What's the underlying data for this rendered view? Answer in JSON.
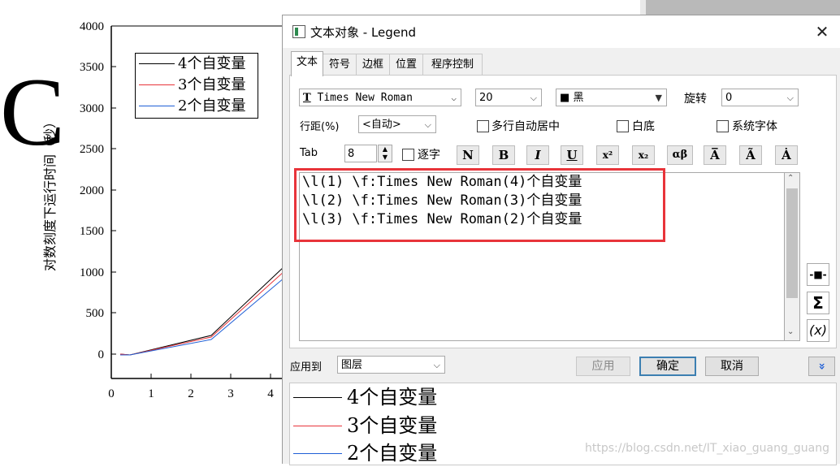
{
  "plot": {
    "big_letter": "C",
    "y_axis_label": "对数刻度下运行时间（秒）",
    "y_ticks": [
      "4000",
      "3500",
      "3000",
      "2500",
      "2000",
      "1500",
      "1000",
      "500",
      "0"
    ],
    "x_ticks": [
      "0",
      "1",
      "2",
      "3",
      "4"
    ],
    "legend": [
      {
        "label": "4个自变量",
        "color": "#000000"
      },
      {
        "label": "3个自变量",
        "color": "#e8343a"
      },
      {
        "label": "2个自变量",
        "color": "#1f5fd6"
      }
    ]
  },
  "dialog": {
    "title": "文本对象 - Legend",
    "close_glyph": "✕",
    "tabs": [
      "文本",
      "符号",
      "边框",
      "位置",
      "程序控制"
    ],
    "font_combo": "Times New Roman",
    "font_icon": "T",
    "size_combo": "20",
    "color_combo": "黑",
    "rotate_label": "旋转",
    "rotate_combo": "0",
    "line_spacing_label": "行距(%)",
    "line_spacing_combo": "<自动>",
    "multiline_center_label": "多行自动居中",
    "white_bg_label": "白底",
    "system_font_label": "系统字体",
    "tab_label": "Tab",
    "tab_value": "8",
    "char_by_char_label": "逐字",
    "format_buttons": [
      "N",
      "B",
      "I",
      "U",
      "x²",
      "x₂",
      "αβ",
      "A̅",
      "Ã",
      "Ȧ"
    ],
    "editor_lines": [
      "\\l(1) \\f:Times New Roman(4)个自变量",
      "\\l(2) \\f:Times New Roman(3)个自变量",
      "\\l(3) \\f:Times New Roman(2)个自变量"
    ],
    "side_buttons": [
      "-■-",
      "Σ",
      "(x)"
    ],
    "apply_to_label": "应用到",
    "apply_to_combo": "图层",
    "apply_button": "应用",
    "ok_button": "确定",
    "cancel_button": "取消",
    "expand_glyph": "»",
    "preview": [
      {
        "label": "4个自变量",
        "color": "#000000"
      },
      {
        "label": "3个自变量",
        "color": "#e8343a"
      },
      {
        "label": "2个自变量",
        "color": "#1f5fd6"
      }
    ]
  },
  "watermark": "https://blog.csdn.net/IT_xiao_guang_guang"
}
